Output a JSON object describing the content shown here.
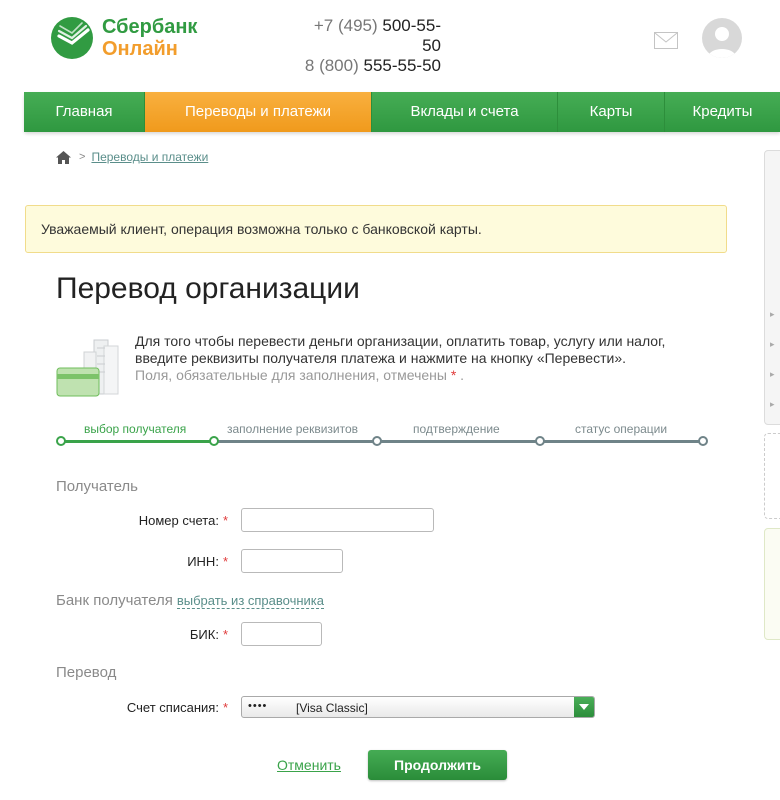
{
  "brand": {
    "line1": "Сбербанк",
    "line2": "Онлайн",
    "green": "#319b42",
    "orange": "#f29d2c"
  },
  "phones": [
    {
      "prefix": "+7 (495) ",
      "number": "500-55-50"
    },
    {
      "prefix": "8 (800) ",
      "number": "555-55-50"
    }
  ],
  "header_icons": {
    "mail": "mail-icon",
    "avatar": "user-avatar-icon"
  },
  "nav": {
    "items": [
      {
        "label": "Главная"
      },
      {
        "label": "Переводы и платежи",
        "active": true
      },
      {
        "label": "Вклады и счета"
      },
      {
        "label": "Карты"
      },
      {
        "label": "Кредиты"
      }
    ],
    "color": "#3aa34a",
    "active_color": "#f5a42c"
  },
  "breadcrumb": {
    "home_icon": "home-icon",
    "separator": ">",
    "current": "Переводы и платежи"
  },
  "notice": "Уважаемый клиент, операция возможна только с банковской карты.",
  "title": "Перевод организации",
  "description": {
    "text": "Для того чтобы перевести деньги организации, оплатить товар, услугу или налог, введите реквизиты получателя платежа и нажмите на кнопку «Перевести».",
    "required_note": "Поля, обязательные для заполнения, отмечены",
    "required_star": "*",
    "required_end": "."
  },
  "steps": [
    {
      "label": "выбор получателя",
      "active": true
    },
    {
      "label": "заполнение реквизитов"
    },
    {
      "label": "подтверждение"
    },
    {
      "label": "статус операции"
    }
  ],
  "form": {
    "recipient_section": "Получатель",
    "account_label": "Номер счета:",
    "inn_label": "ИНН:",
    "bank_section": "Банк получателя",
    "bank_link": "выбрать из справочника",
    "bik_label": "БИК:",
    "transfer_section": "Перевод",
    "debit_label": "Счет списания:",
    "star": "*",
    "debit_select": {
      "mask": "••••",
      "card": "[Visa Classic]"
    },
    "account_value": "",
    "inn_value": "",
    "bik_value": ""
  },
  "actions": {
    "cancel": "Отменить",
    "continue": "Продолжить"
  }
}
